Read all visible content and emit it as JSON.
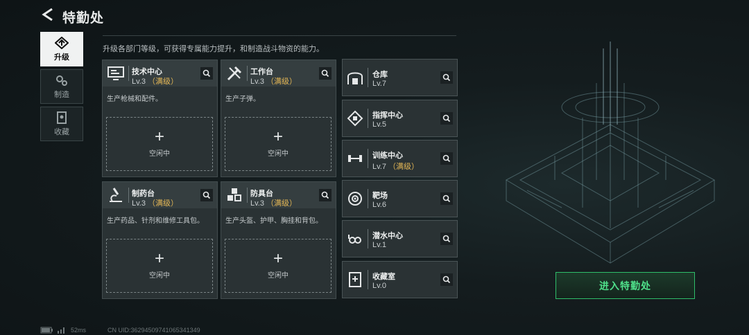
{
  "header": {
    "title": "特勤处",
    "back_icon": "back-arrow-icon"
  },
  "description": "升级各部门等级，可获得专属能力提升，和制造战斗物资的能力。",
  "tabs": [
    {
      "label": "升级",
      "icon": "upgrade-icon",
      "active": true
    },
    {
      "label": "制造",
      "icon": "gears-icon",
      "active": false
    },
    {
      "label": "收藏",
      "icon": "collection-icon",
      "active": false
    }
  ],
  "big_cards": [
    {
      "name": "技术中心",
      "level": "Lv.3",
      "max_label": "（满级）",
      "desc": "生产枪械和配件。",
      "slot_label": "空闲中",
      "plus": "+"
    },
    {
      "name": "工作台",
      "level": "Lv.3",
      "max_label": "（满级）",
      "desc": "生产子弹。",
      "slot_label": "空闲中",
      "plus": "+"
    },
    {
      "name": "制药台",
      "level": "Lv.3",
      "max_label": "（满级）",
      "desc": "生产药品、针剂和维修工具包。",
      "slot_label": "空闲中",
      "plus": "+"
    },
    {
      "name": "防具台",
      "level": "Lv.3",
      "max_label": "（满级）",
      "desc": "生产头盔、护甲、胸挂和背包。",
      "slot_label": "空闲中",
      "plus": "+"
    }
  ],
  "small_cards": [
    {
      "name": "仓库",
      "level": "Lv.7",
      "max_label": ""
    },
    {
      "name": "指挥中心",
      "level": "Lv.5",
      "max_label": ""
    },
    {
      "name": "训练中心",
      "level": "Lv.7",
      "max_label": "（满级）"
    },
    {
      "name": "靶场",
      "level": "Lv.6",
      "max_label": ""
    },
    {
      "name": "潜水中心",
      "level": "Lv.1",
      "max_label": ""
    },
    {
      "name": "收藏室",
      "level": "Lv.0",
      "max_label": ""
    }
  ],
  "enter_button": "进入特勤处",
  "footer": {
    "ping": "52ms",
    "uid": "CN UID:3629450974106534134​9"
  },
  "colors": {
    "accent_green": "#4fe08a",
    "max_gold": "#e3b655"
  }
}
